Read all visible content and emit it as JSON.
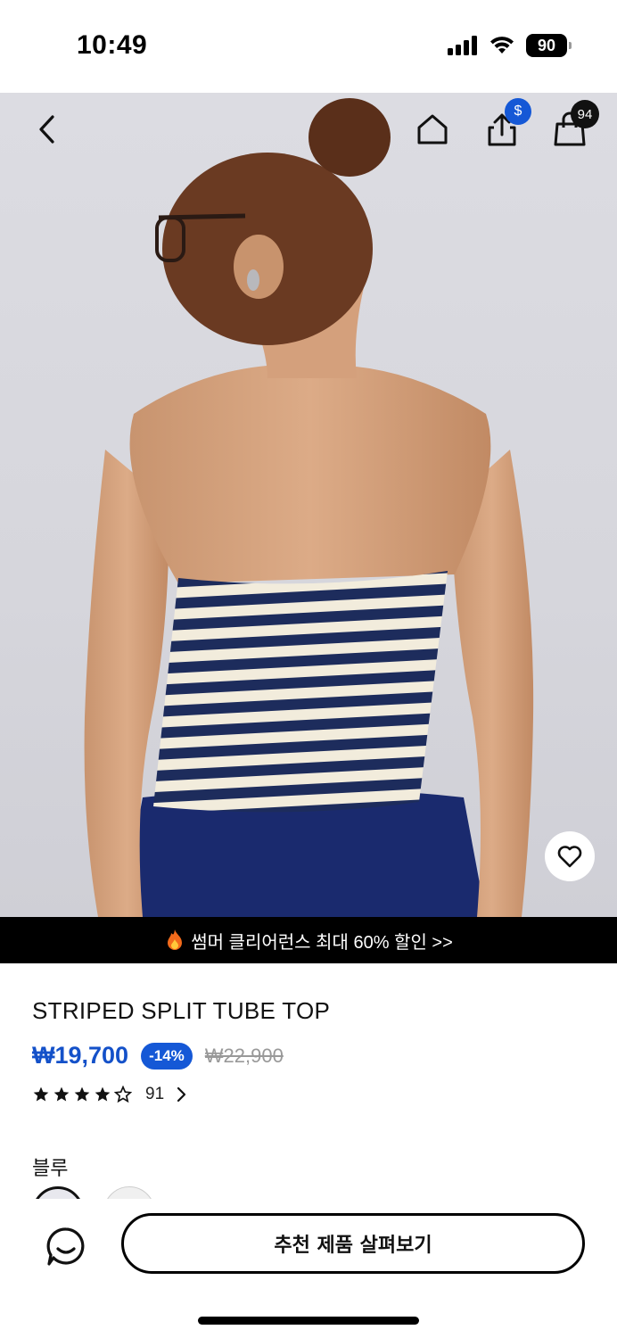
{
  "status_bar": {
    "time": "10:49",
    "battery": "90"
  },
  "header": {
    "icons": [
      "back-icon",
      "home-icon",
      "share-icon",
      "shopping-bag-icon"
    ],
    "share_badge": "$",
    "cart_count": "94"
  },
  "promo": {
    "text": "썸머 클리어런스 최대 60% 할인 >>"
  },
  "product": {
    "title": "STRIPED SPLIT TUBE TOP",
    "price": "₩19,700",
    "discount": "-14%",
    "original_price": "₩22,900",
    "rating": 4,
    "rating_max": 5,
    "review_count": "91",
    "color_label": "블루"
  },
  "actions": {
    "recommend_label": "추천 제품 살펴보기"
  },
  "colors": {
    "accent": "#1558d6",
    "price": "#1451c9",
    "banner": "#000000"
  }
}
